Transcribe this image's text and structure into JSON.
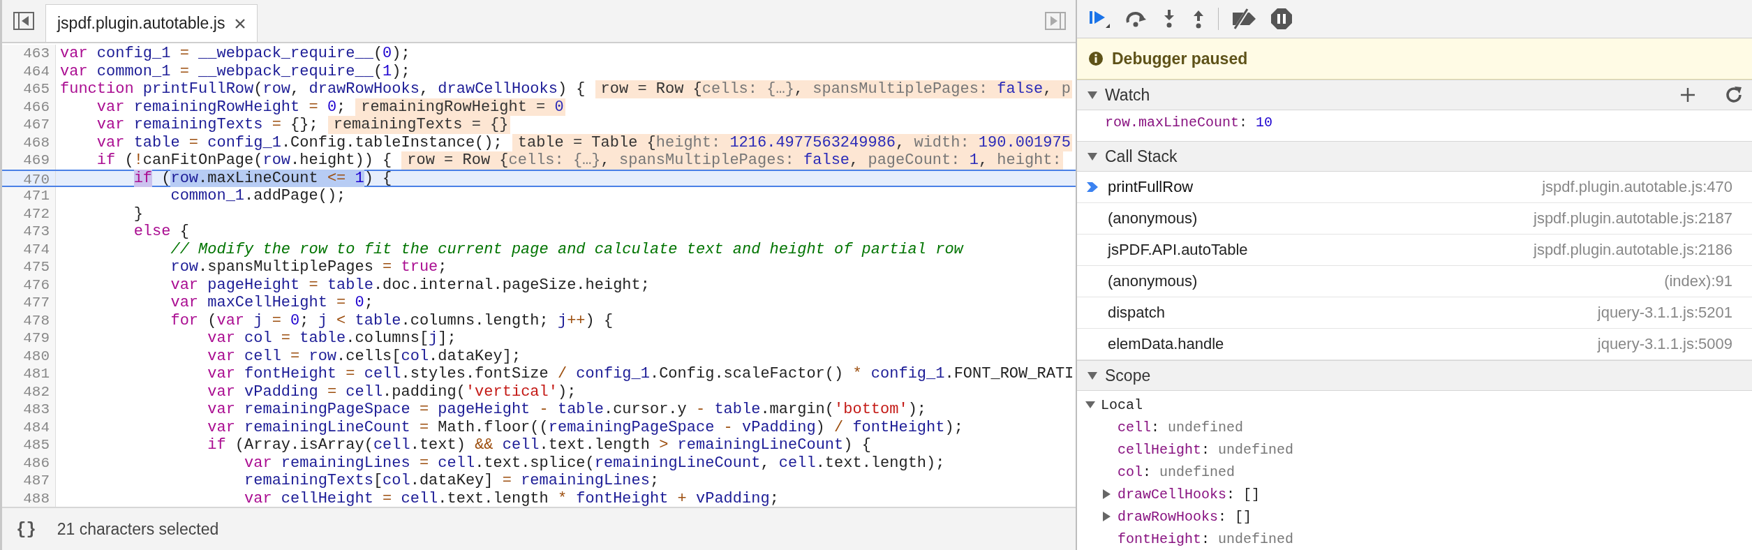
{
  "editor": {
    "tabs": [
      {
        "label": "jspdf.plugin.autotable.js",
        "selected": true
      }
    ],
    "lines": [
      {
        "number": "463",
        "tokens": [
          {
            "kind": "kw",
            "text": "var"
          },
          {
            "kind": "var",
            "text": " config_1"
          },
          {
            "kind": "op",
            "text": " ="
          },
          {
            "kind": "var",
            "text": " __webpack_require__"
          },
          {
            "kind": "pn",
            "text": "("
          },
          {
            "kind": "num",
            "text": "0"
          },
          {
            "kind": "pn",
            "text": ");"
          }
        ]
      },
      {
        "number": "464",
        "tokens": [
          {
            "kind": "kw",
            "text": "var"
          },
          {
            "kind": "var",
            "text": " common_1"
          },
          {
            "kind": "op",
            "text": " ="
          },
          {
            "kind": "var",
            "text": " __webpack_require__"
          },
          {
            "kind": "pn",
            "text": "("
          },
          {
            "kind": "num",
            "text": "1"
          },
          {
            "kind": "pn",
            "text": ");"
          }
        ]
      },
      {
        "number": "465",
        "tokens": [
          {
            "kind": "kw",
            "text": "function"
          },
          {
            "kind": "var",
            "text": " printFullRow"
          },
          {
            "kind": "pn",
            "text": "("
          },
          {
            "kind": "var",
            "text": "row"
          },
          {
            "kind": "pn",
            "text": ","
          },
          {
            "kind": "var",
            "text": " drawRowHooks"
          },
          {
            "kind": "pn",
            "text": ","
          },
          {
            "kind": "var",
            "text": " drawCellHooks"
          },
          {
            "kind": "pn",
            "text": ") {"
          }
        ],
        "inline_value": [
          {
            "kind": "name",
            "text": "row = Row {"
          },
          {
            "kind": "key",
            "text": "cells: {…}"
          },
          {
            "kind": "name",
            "text": ","
          },
          {
            "kind": "key",
            "text": " spansMultiplePages:"
          },
          {
            "kind": "val",
            "text": " false"
          },
          {
            "kind": "name",
            "text": ","
          },
          {
            "kind": "key",
            "text": " p"
          }
        ]
      },
      {
        "number": "466",
        "tokens": [
          {
            "kind": "kw",
            "text": "    var"
          },
          {
            "kind": "var",
            "text": " remainingRowHeight"
          },
          {
            "kind": "op",
            "text": " ="
          },
          {
            "kind": "num",
            "text": " 0"
          },
          {
            "kind": "pn",
            "text": ";"
          }
        ],
        "inline_value": [
          {
            "kind": "name",
            "text": "remainingRowHeight ="
          },
          {
            "kind": "val",
            "text": " 0"
          }
        ]
      },
      {
        "number": "467",
        "tokens": [
          {
            "kind": "kw",
            "text": "    var"
          },
          {
            "kind": "var",
            "text": " remainingTexts"
          },
          {
            "kind": "op",
            "text": " ="
          },
          {
            "kind": "pn",
            "text": " {};"
          }
        ],
        "inline_value": [
          {
            "kind": "name",
            "text": "remainingTexts = {}"
          }
        ]
      },
      {
        "number": "468",
        "tokens": [
          {
            "kind": "kw",
            "text": "    var"
          },
          {
            "kind": "var",
            "text": " table"
          },
          {
            "kind": "op",
            "text": " ="
          },
          {
            "kind": "var",
            "text": " config_1"
          },
          {
            "kind": "pn",
            "text": ".Config.tableInstance();"
          }
        ],
        "inline_value": [
          {
            "kind": "name",
            "text": "table = Table {"
          },
          {
            "kind": "key",
            "text": "height:"
          },
          {
            "kind": "val",
            "text": " 1216.4977563249986"
          },
          {
            "kind": "name",
            "text": ","
          },
          {
            "kind": "key",
            "text": " width:"
          },
          {
            "kind": "val",
            "text": " 190.001975"
          }
        ]
      },
      {
        "number": "469",
        "tokens": [
          {
            "kind": "kw",
            "text": "    if"
          },
          {
            "kind": "pn",
            "text": " ("
          },
          {
            "kind": "op",
            "text": "!"
          },
          {
            "kind": "pn",
            "text": "canFitOnPage("
          },
          {
            "kind": "var",
            "text": "row"
          },
          {
            "kind": "pn",
            "text": ".height)) {"
          }
        ],
        "inline_value": [
          {
            "kind": "name",
            "text": "row = Row {"
          },
          {
            "kind": "key",
            "text": "cells: {…}"
          },
          {
            "kind": "name",
            "text": ","
          },
          {
            "kind": "key",
            "text": " spansMultiplePages:"
          },
          {
            "kind": "val",
            "text": " false"
          },
          {
            "kind": "name",
            "text": ","
          },
          {
            "kind": "key",
            "text": " pageCount:"
          },
          {
            "kind": "val",
            "text": " 1"
          },
          {
            "kind": "name",
            "text": ","
          },
          {
            "kind": "key",
            "text": " height:"
          }
        ]
      },
      {
        "number": "470",
        "current": true,
        "tokens": [
          {
            "kind": "kw",
            "text": "        if",
            "selected": false,
            "highlighted": true
          },
          {
            "kind": "pn",
            "text": " (",
            "selected": false,
            "highlighted": false
          },
          {
            "kind": "var",
            "text": "row",
            "selected": true,
            "highlighted": false
          },
          {
            "kind": "pn",
            "text": ".maxLineCount",
            "selected": true,
            "highlighted": false
          },
          {
            "kind": "op",
            "text": " <=",
            "selected": true,
            "highlighted": false
          },
          {
            "kind": "num",
            "text": " 1",
            "selected": true,
            "highlighted": false
          },
          {
            "kind": "pn",
            "text": ") {",
            "selected": false,
            "highlighted": false
          }
        ]
      },
      {
        "number": "471",
        "tokens": [
          {
            "kind": "var",
            "text": "            common_1"
          },
          {
            "kind": "pn",
            "text": ".addPage();"
          }
        ]
      },
      {
        "number": "472",
        "tokens": [
          {
            "kind": "pn",
            "text": "        }"
          }
        ]
      },
      {
        "number": "473",
        "tokens": [
          {
            "kind": "kw",
            "text": "        else"
          },
          {
            "kind": "pn",
            "text": " {"
          }
        ]
      },
      {
        "number": "474",
        "tokens": [
          {
            "kind": "cm",
            "text": "            // Modify the row to fit the current page and calculate text and height of partial row"
          }
        ]
      },
      {
        "number": "475",
        "tokens": [
          {
            "kind": "var",
            "text": "            row"
          },
          {
            "kind": "pn",
            "text": ".spansMultiplePages"
          },
          {
            "kind": "op",
            "text": " ="
          },
          {
            "kind": "kw",
            "text": " true"
          },
          {
            "kind": "pn",
            "text": ";"
          }
        ]
      },
      {
        "number": "476",
        "tokens": [
          {
            "kind": "kw",
            "text": "            var"
          },
          {
            "kind": "var",
            "text": " pageHeight"
          },
          {
            "kind": "op",
            "text": " ="
          },
          {
            "kind": "var",
            "text": " table"
          },
          {
            "kind": "pn",
            "text": ".doc.internal.pageSize.height;"
          }
        ]
      },
      {
        "number": "477",
        "tokens": [
          {
            "kind": "kw",
            "text": "            var"
          },
          {
            "kind": "var",
            "text": " maxCellHeight"
          },
          {
            "kind": "op",
            "text": " ="
          },
          {
            "kind": "num",
            "text": " 0"
          },
          {
            "kind": "pn",
            "text": ";"
          }
        ]
      },
      {
        "number": "478",
        "tokens": [
          {
            "kind": "kw",
            "text": "            for"
          },
          {
            "kind": "pn",
            "text": " ("
          },
          {
            "kind": "kw",
            "text": "var"
          },
          {
            "kind": "var",
            "text": " j"
          },
          {
            "kind": "op",
            "text": " ="
          },
          {
            "kind": "num",
            "text": " 0"
          },
          {
            "kind": "pn",
            "text": ";"
          },
          {
            "kind": "var",
            "text": " j"
          },
          {
            "kind": "op",
            "text": " <"
          },
          {
            "kind": "var",
            "text": " table"
          },
          {
            "kind": "pn",
            "text": ".columns.length;"
          },
          {
            "kind": "var",
            "text": " j"
          },
          {
            "kind": "op",
            "text": "++"
          },
          {
            "kind": "pn",
            "text": ") {"
          }
        ]
      },
      {
        "number": "479",
        "tokens": [
          {
            "kind": "kw",
            "text": "                var"
          },
          {
            "kind": "var",
            "text": " col"
          },
          {
            "kind": "op",
            "text": " ="
          },
          {
            "kind": "var",
            "text": " table"
          },
          {
            "kind": "pn",
            "text": ".columns["
          },
          {
            "kind": "var",
            "text": "j"
          },
          {
            "kind": "pn",
            "text": "];"
          }
        ]
      },
      {
        "number": "480",
        "tokens": [
          {
            "kind": "kw",
            "text": "                var"
          },
          {
            "kind": "var",
            "text": " cell"
          },
          {
            "kind": "op",
            "text": " ="
          },
          {
            "kind": "var",
            "text": " row"
          },
          {
            "kind": "pn",
            "text": ".cells["
          },
          {
            "kind": "var",
            "text": "col"
          },
          {
            "kind": "pn",
            "text": ".dataKey];"
          }
        ]
      },
      {
        "number": "481",
        "tokens": [
          {
            "kind": "kw",
            "text": "                var"
          },
          {
            "kind": "var",
            "text": " fontHeight"
          },
          {
            "kind": "op",
            "text": " ="
          },
          {
            "kind": "var",
            "text": " cell"
          },
          {
            "kind": "pn",
            "text": ".styles.fontSize"
          },
          {
            "kind": "op",
            "text": " /"
          },
          {
            "kind": "var",
            "text": " config_1"
          },
          {
            "kind": "pn",
            "text": ".Config.scaleFactor()"
          },
          {
            "kind": "op",
            "text": " *"
          },
          {
            "kind": "var",
            "text": " config_1"
          },
          {
            "kind": "pn",
            "text": ".FONT_ROW_RATI"
          }
        ]
      },
      {
        "number": "482",
        "tokens": [
          {
            "kind": "kw",
            "text": "                var"
          },
          {
            "kind": "var",
            "text": " vPadding"
          },
          {
            "kind": "op",
            "text": " ="
          },
          {
            "kind": "var",
            "text": " cell"
          },
          {
            "kind": "pn",
            "text": ".padding("
          },
          {
            "kind": "str",
            "text": "'vertical'"
          },
          {
            "kind": "pn",
            "text": ");"
          }
        ]
      },
      {
        "number": "483",
        "tokens": [
          {
            "kind": "kw",
            "text": "                var"
          },
          {
            "kind": "var",
            "text": " remainingPageSpace"
          },
          {
            "kind": "op",
            "text": " ="
          },
          {
            "kind": "var",
            "text": " pageHeight"
          },
          {
            "kind": "op",
            "text": " -"
          },
          {
            "kind": "var",
            "text": " table"
          },
          {
            "kind": "pn",
            "text": ".cursor.y"
          },
          {
            "kind": "op",
            "text": " -"
          },
          {
            "kind": "var",
            "text": " table"
          },
          {
            "kind": "pn",
            "text": ".margin("
          },
          {
            "kind": "str",
            "text": "'bottom'"
          },
          {
            "kind": "pn",
            "text": ");"
          }
        ]
      },
      {
        "number": "484",
        "tokens": [
          {
            "kind": "kw",
            "text": "                var"
          },
          {
            "kind": "var",
            "text": " remainingLineCount"
          },
          {
            "kind": "op",
            "text": " ="
          },
          {
            "kind": "pn",
            "text": " Math.floor(("
          },
          {
            "kind": "var",
            "text": "remainingPageSpace"
          },
          {
            "kind": "op",
            "text": " -"
          },
          {
            "kind": "var",
            "text": " vPadding"
          },
          {
            "kind": "pn",
            "text": ")"
          },
          {
            "kind": "op",
            "text": " /"
          },
          {
            "kind": "var",
            "text": " fontHeight"
          },
          {
            "kind": "pn",
            "text": ");"
          }
        ]
      },
      {
        "number": "485",
        "tokens": [
          {
            "kind": "kw",
            "text": "                if"
          },
          {
            "kind": "pn",
            "text": " (Array.isArray("
          },
          {
            "kind": "var",
            "text": "cell"
          },
          {
            "kind": "pn",
            "text": ".text)"
          },
          {
            "kind": "op",
            "text": " &&"
          },
          {
            "kind": "var",
            "text": " cell"
          },
          {
            "kind": "pn",
            "text": ".text.length"
          },
          {
            "kind": "op",
            "text": " >"
          },
          {
            "kind": "var",
            "text": " remainingLineCount"
          },
          {
            "kind": "pn",
            "text": ") {"
          }
        ]
      },
      {
        "number": "486",
        "tokens": [
          {
            "kind": "kw",
            "text": "                    var"
          },
          {
            "kind": "var",
            "text": " remainingLines"
          },
          {
            "kind": "op",
            "text": " ="
          },
          {
            "kind": "var",
            "text": " cell"
          },
          {
            "kind": "pn",
            "text": ".text.splice("
          },
          {
            "kind": "var",
            "text": "remainingLineCount"
          },
          {
            "kind": "pn",
            "text": ","
          },
          {
            "kind": "var",
            "text": " cell"
          },
          {
            "kind": "pn",
            "text": ".text.length);"
          }
        ]
      },
      {
        "number": "487",
        "tokens": [
          {
            "kind": "var",
            "text": "                    remainingTexts"
          },
          {
            "kind": "pn",
            "text": "["
          },
          {
            "kind": "var",
            "text": "col"
          },
          {
            "kind": "pn",
            "text": ".dataKey]"
          },
          {
            "kind": "op",
            "text": " ="
          },
          {
            "kind": "var",
            "text": " remainingLines"
          },
          {
            "kind": "pn",
            "text": ";"
          }
        ]
      },
      {
        "number": "488",
        "tokens": [
          {
            "kind": "kw",
            "text": "                    var"
          },
          {
            "kind": "var",
            "text": " cellHeight"
          },
          {
            "kind": "op",
            "text": " ="
          },
          {
            "kind": "var",
            "text": " cell"
          },
          {
            "kind": "pn",
            "text": ".text.length"
          },
          {
            "kind": "op",
            "text": " *"
          },
          {
            "kind": "var",
            "text": " fontHeight"
          },
          {
            "kind": "op",
            "text": " +"
          },
          {
            "kind": "var",
            "text": " vPadding"
          },
          {
            "kind": "pn",
            "text": ";"
          }
        ]
      }
    ],
    "status_bar": {
      "format_button": "{}",
      "text": "21 characters selected"
    }
  },
  "debugger": {
    "banner": "Debugger paused",
    "watch": {
      "title": "Watch",
      "expanded": true,
      "items": [
        {
          "expression": "row.maxLineCount",
          "separator": ":",
          "value": "10"
        }
      ]
    },
    "call_stack": {
      "title": "Call Stack",
      "expanded": true,
      "frames": [
        {
          "function": "printFullRow",
          "location": "jspdf.plugin.autotable.js:470",
          "selected": true
        },
        {
          "function": "(anonymous)",
          "location": "jspdf.plugin.autotable.js:2187",
          "selected": false
        },
        {
          "function": "jsPDF.API.autoTable",
          "location": "jspdf.plugin.autotable.js:2186",
          "selected": false
        },
        {
          "function": "(anonymous)",
          "location": "(index):91",
          "selected": false
        },
        {
          "function": "dispatch",
          "location": "jquery-3.1.1.js:5201",
          "selected": false
        },
        {
          "function": "elemData.handle",
          "location": "jquery-3.1.1.js:5009",
          "selected": false
        }
      ]
    },
    "scope": {
      "title": "Scope",
      "expanded": true,
      "groups": [
        {
          "name": "Local",
          "expanded": true,
          "vars": [
            {
              "name": "cell",
              "separator": ":",
              "value": "undefined",
              "kind": "undefined"
            },
            {
              "name": "cellHeight",
              "separator": ":",
              "value": "undefined",
              "kind": "undefined"
            },
            {
              "name": "col",
              "separator": ":",
              "value": "undefined",
              "kind": "undefined"
            },
            {
              "name": "drawCellHooks",
              "separator": ":",
              "value": "[]",
              "kind": "object",
              "expanded": false
            },
            {
              "name": "drawRowHooks",
              "separator": ":",
              "value": "[]",
              "kind": "object",
              "expanded": false
            },
            {
              "name": "fontHeight",
              "separator": ":",
              "value": "undefined",
              "kind": "undefined"
            }
          ]
        }
      ]
    }
  }
}
